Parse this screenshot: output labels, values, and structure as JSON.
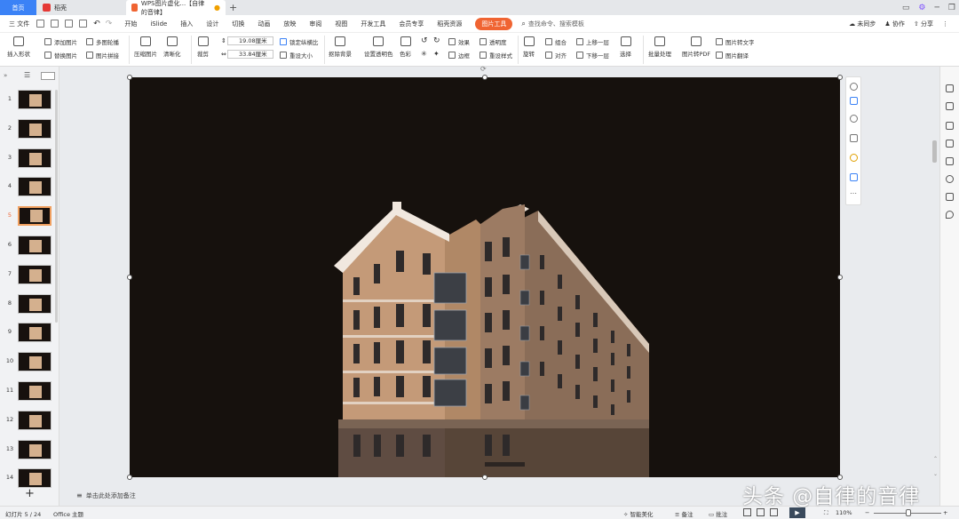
{
  "tabs": {
    "home": "首页",
    "daoke": "稻壳",
    "doc": "WPS图片虚化...【自律的音律】",
    "add": "+"
  },
  "window_controls": [
    "▭",
    "⚙",
    "─",
    "❐"
  ],
  "menu": {
    "file": "三 文件",
    "items": [
      "开始",
      "iSlide",
      "插入",
      "设计",
      "切换",
      "动画",
      "放映",
      "审阅",
      "视图",
      "开发工具",
      "会员专享",
      "稻壳资源"
    ],
    "active_tool": "图片工具",
    "search_cmd": "查找命令、搜索模板",
    "right": [
      "未同步",
      "协作",
      "分享"
    ]
  },
  "ribbon": {
    "insert_shape": "插入形状",
    "add_picture": "添加图片",
    "replace_picture": "替换图片",
    "multi_outline": "多图轮播",
    "picture_stitch": "图片拼接",
    "compress": "压缩图片",
    "sharpen": "清晰化",
    "crop": "裁剪",
    "height": "19.08厘米",
    "width": "33.84厘米",
    "lock_ratio": "锁定纵横比",
    "reset_size": "重设大小",
    "remove_bg": "抠除背景",
    "set_transparent": "设置透明色",
    "color": "色彩",
    "effects": "效果",
    "border": "边框",
    "transparency": "透明度",
    "reset_style": "重设样式",
    "rotate": "旋转",
    "group": "组合",
    "align": "对齐",
    "bring_forward": "上移一层",
    "send_backward": "下移一层",
    "select": "选择",
    "batch": "批量处理",
    "to_pdf": "图片转PDF",
    "to_text": "图片转文字",
    "translate": "图片翻译"
  },
  "slides": [
    "1",
    "2",
    "3",
    "4",
    "5",
    "6",
    "7",
    "8",
    "9",
    "10",
    "11",
    "12",
    "13",
    "14"
  ],
  "selected_slide": "5",
  "add_slide": "+",
  "note_placeholder": "单击此处添加备注",
  "status": {
    "slide_info": "幻灯片 5 / 24",
    "theme": "Office 主题",
    "smart_beautify": "智能美化",
    "notes": "备注",
    "comments": "批注",
    "zoom": "110%"
  },
  "watermark": "头条 @自律的音律",
  "colors": {
    "accent": "#f06432",
    "home_tab": "#3b82f6",
    "canvas_bg": "#16110d"
  }
}
